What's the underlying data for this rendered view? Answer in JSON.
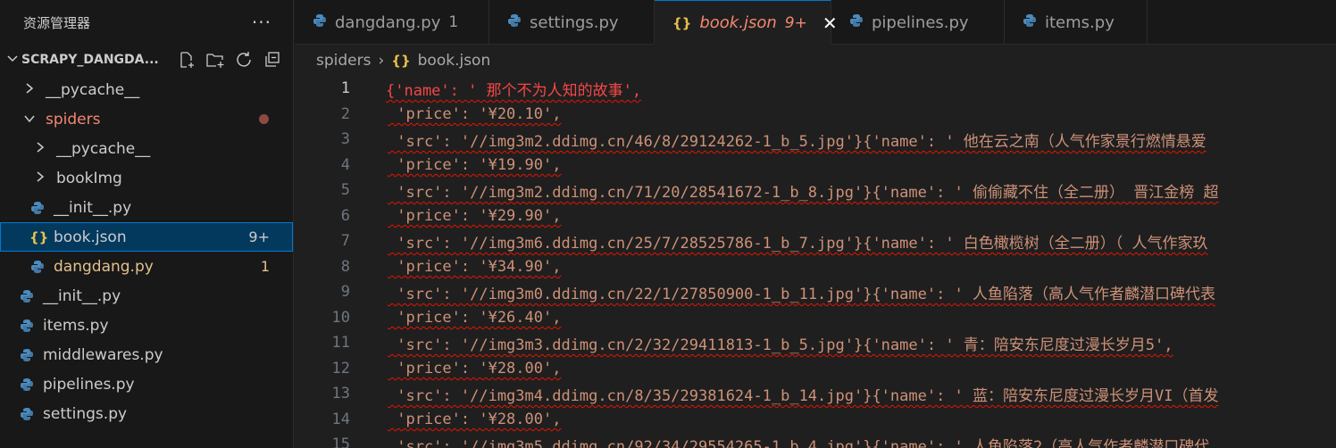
{
  "sidebar": {
    "title": "资源管理器",
    "more": "···",
    "project": "SCRAPY_DANGDA...",
    "items": [
      {
        "label": "__pycache__",
        "kind": "folder",
        "indent": 1
      },
      {
        "label": "spiders",
        "kind": "folder-open",
        "indent": 1
      },
      {
        "label": "__pycache__",
        "kind": "folder",
        "indent": 2
      },
      {
        "label": "bookImg",
        "kind": "folder",
        "indent": 2
      },
      {
        "label": "__init__.py",
        "kind": "py",
        "indent": 2
      },
      {
        "label": "book.json",
        "kind": "json",
        "indent": 2,
        "badge": "9+"
      },
      {
        "label": "dangdang.py",
        "kind": "py",
        "indent": 2,
        "badge": "1"
      },
      {
        "label": "__init__.py",
        "kind": "py",
        "indent": 1
      },
      {
        "label": "items.py",
        "kind": "py",
        "indent": 1
      },
      {
        "label": "middlewares.py",
        "kind": "py",
        "indent": 1
      },
      {
        "label": "pipelines.py",
        "kind": "py",
        "indent": 1
      },
      {
        "label": "settings.py",
        "kind": "py",
        "indent": 1
      }
    ]
  },
  "tabs": [
    {
      "label": "dangdang.py",
      "badge": "1"
    },
    {
      "label": "settings.py"
    },
    {
      "label": "book.json",
      "badge": "9+"
    },
    {
      "label": "pipelines.py"
    },
    {
      "label": "items.py"
    }
  ],
  "breadcrumb": {
    "folder": "spiders",
    "sep": "›",
    "icon": "{}",
    "file": "book.json"
  },
  "editor": {
    "lines": [
      {
        "n": "1",
        "text": "{'name': ' 那个不为人知的故事',"
      },
      {
        "n": "2",
        "text": " 'price': '¥20.10',"
      },
      {
        "n": "3",
        "text": " 'src': '//img3m2.ddimg.cn/46/8/29124262-1_b_5.jpg'}{'name': ' 他在云之南（人气作家景行燃情悬爱"
      },
      {
        "n": "4",
        "text": " 'price': '¥19.90',"
      },
      {
        "n": "5",
        "text": " 'src': '//img3m2.ddimg.cn/71/20/28541672-1_b_8.jpg'}{'name': ' 偷偷藏不住（全二册） 晋江金榜 超"
      },
      {
        "n": "6",
        "text": " 'price': '¥29.90',"
      },
      {
        "n": "7",
        "text": " 'src': '//img3m6.ddimg.cn/25/7/28525786-1_b_7.jpg'}{'name': ' 白色橄榄树（全二册）（ 人气作家玖"
      },
      {
        "n": "8",
        "text": " 'price': '¥34.90',"
      },
      {
        "n": "9",
        "text": " 'src': '//img3m0.ddimg.cn/22/1/27850900-1_b_11.jpg'}{'name': ' 人鱼陷落（高人气作者麟潜口碑代表"
      },
      {
        "n": "10",
        "text": " 'price': '¥26.40',"
      },
      {
        "n": "11",
        "text": " 'src': '//img3m3.ddimg.cn/2/32/29411813-1_b_5.jpg'}{'name': ' 青：陪安东尼度过漫长岁月5',"
      },
      {
        "n": "12",
        "text": " 'price': '¥28.00',"
      },
      {
        "n": "13",
        "text": " 'src': '//img3m4.ddimg.cn/8/35/29381624-1_b_14.jpg'}{'name': ' 蓝：陪安东尼度过漫长岁月VI（首发"
      },
      {
        "n": "14",
        "text": " 'price': '¥28.00',"
      },
      {
        "n": "15",
        "text": " 'src': '//img3m5.ddimg.cn/92/34/29554265-1_b_4.jpg'}{'name': ' 人鱼陷落2（高人气作者麟潜口碑代"
      }
    ]
  },
  "colors": {
    "accent": "#0078d4",
    "string": "#ce9178",
    "error": "#f48771",
    "warning": "#e2c08d",
    "json_icon": "#e8c14a",
    "python_icon": "#4b8bbe"
  }
}
